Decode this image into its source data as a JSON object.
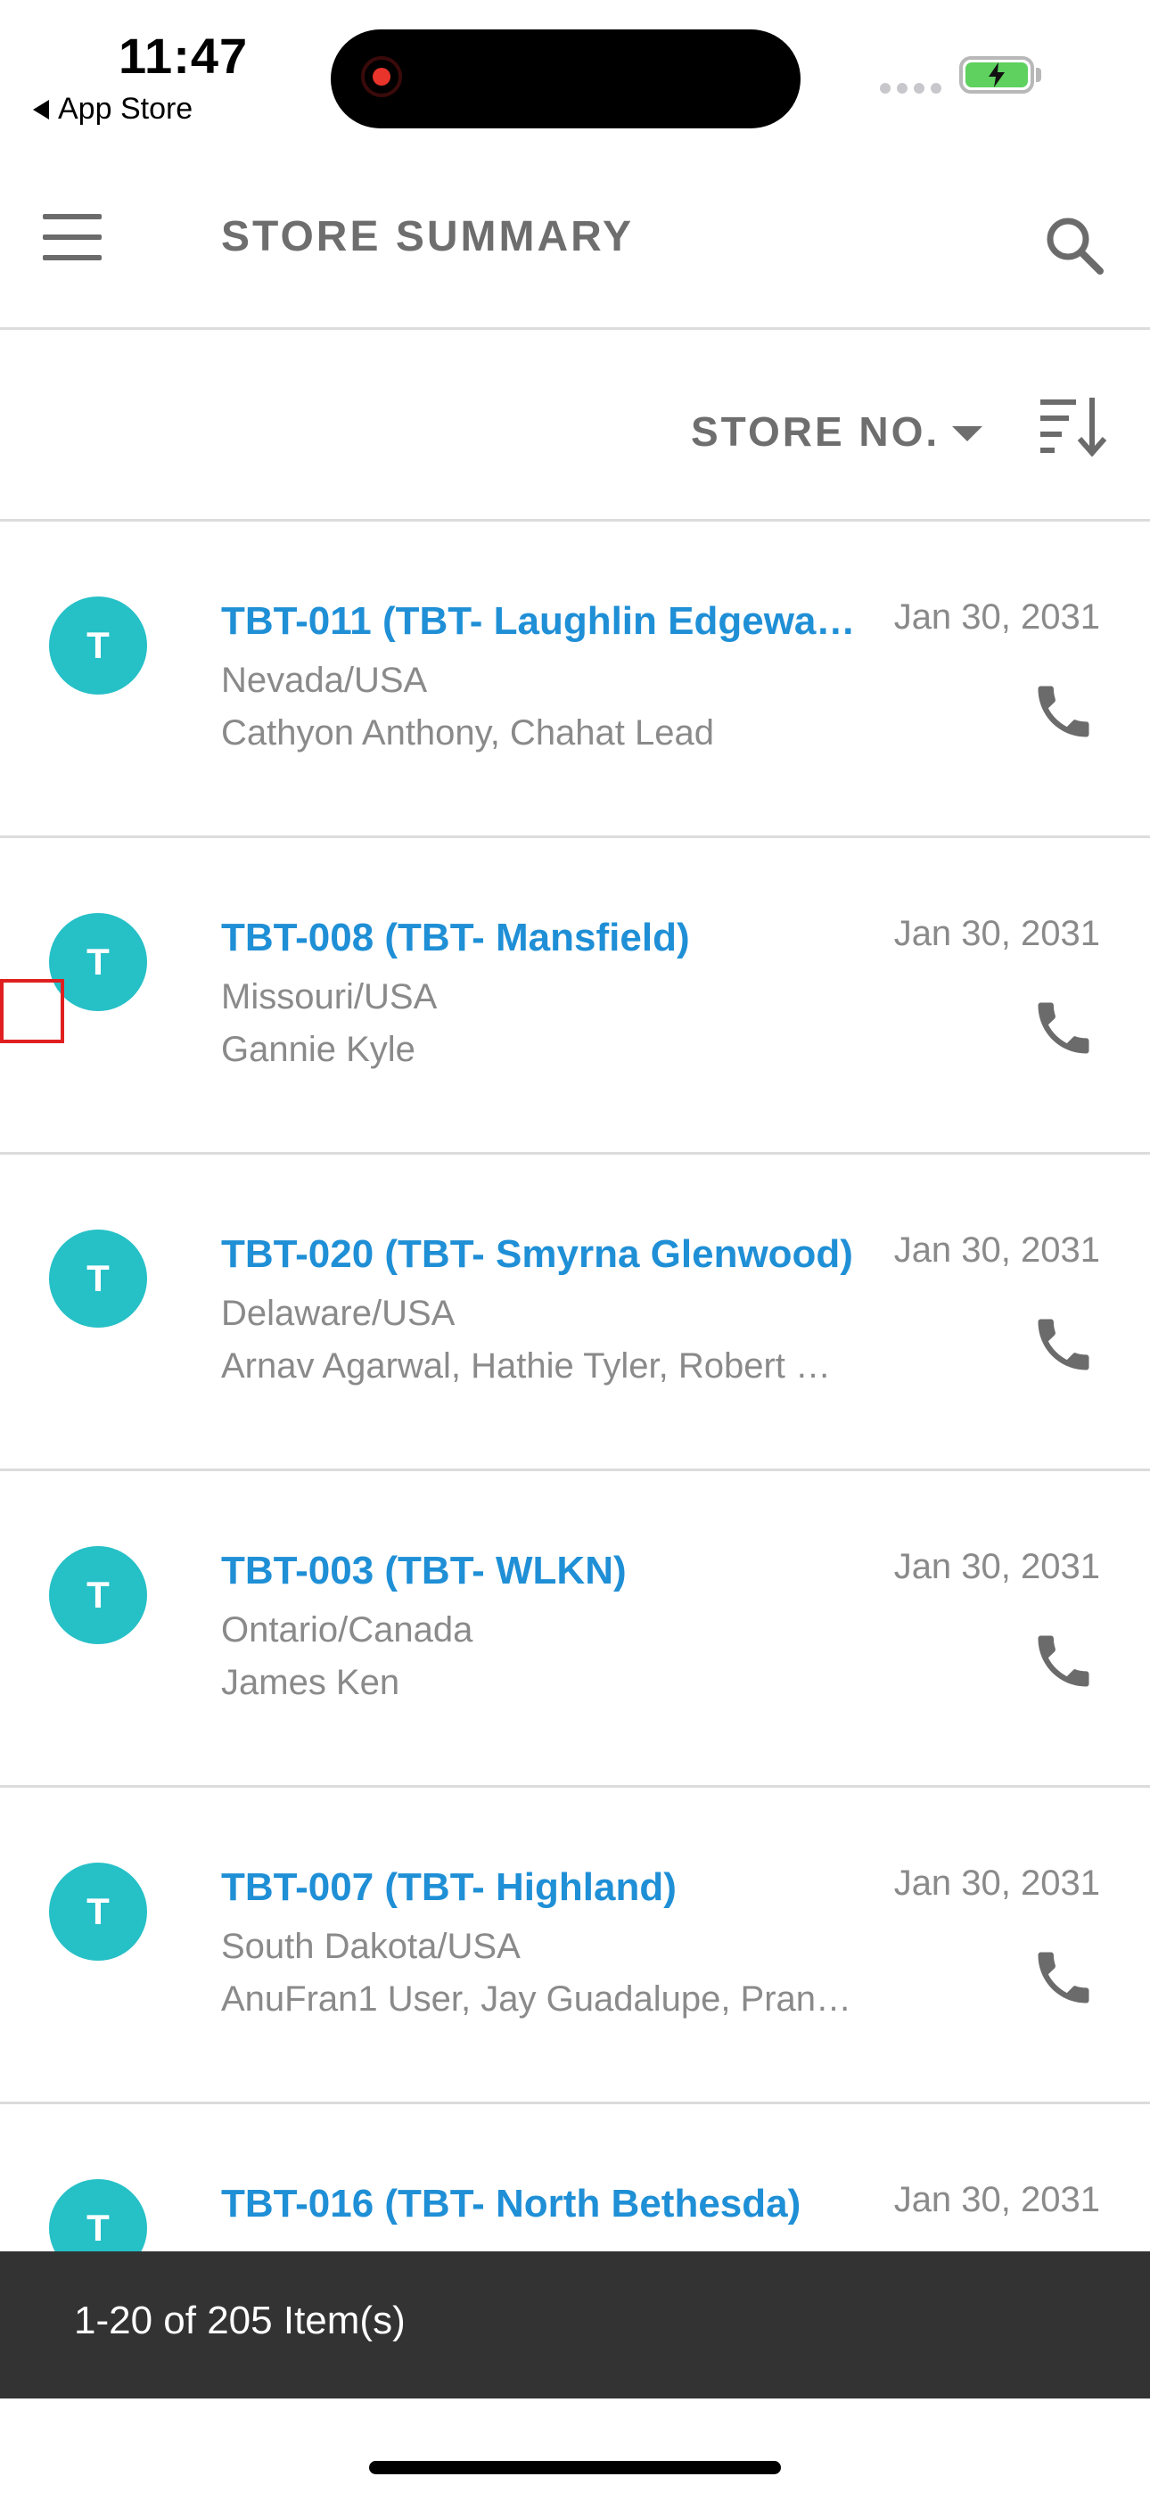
{
  "status_bar": {
    "time": "11:47",
    "back_label": "App Store",
    "battery_color": "#5ed15f",
    "recording_color": "#e8342b"
  },
  "header": {
    "title": "STORE SUMMARY",
    "menu_icon": "hamburger-menu-icon",
    "search_icon": "search-icon"
  },
  "sort": {
    "field_label": "STORE NO.",
    "direction_icon": "sort-descending-icon"
  },
  "stores": [
    {
      "avatar": "T",
      "title": "TBT-011 (TBT- Laughlin Edgewat…",
      "region": "Nevada/USA",
      "contacts": "Cathyon Anthony, Chahat Lead",
      "date": "Jan 30, 2031"
    },
    {
      "avatar": "T",
      "title": "TBT-008 (TBT- Mansfield)",
      "region": "Missouri/USA",
      "contacts": "Gannie Kyle",
      "date": "Jan 30, 2031"
    },
    {
      "avatar": "T",
      "title": "TBT-020 (TBT- Smyrna Glenwood)",
      "region": "Delaware/USA",
      "contacts": "Arnav Agarwal, Hathie Tyler, Robert …",
      "date": "Jan 30, 2031"
    },
    {
      "avatar": "T",
      "title": "TBT-003 (TBT- WLKN)",
      "region": "Ontario/Canada",
      "contacts": "James Ken",
      "date": "Jan 30, 2031"
    },
    {
      "avatar": "T",
      "title": "TBT-007 (TBT- Highland)",
      "region": "South Dakota/USA",
      "contacts": "AnuFran1 User, Jay Guadalupe, Pran…",
      "date": "Jan 30, 2031"
    },
    {
      "avatar": "T",
      "title": "TBT-016 (TBT- North Bethesda)",
      "region": "",
      "contacts": "",
      "date": "Jan 30, 2031"
    }
  ],
  "footer": {
    "item_count": "1-20 of 205 Item(s)"
  },
  "colors": {
    "accent": "#1f8fd6",
    "avatar": "#26c0c7",
    "muted_text": "#8a8a8a",
    "footer_bg": "#333333"
  }
}
